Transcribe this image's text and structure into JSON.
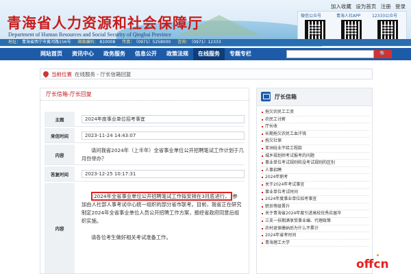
{
  "header": {
    "title": "青海省人力资源和社会保障厅",
    "subtitle": "Department of Human Resources and Social Security of Qinghai Province",
    "toplinks": [
      "加入收藏",
      "设为首页",
      "注册",
      "登录"
    ],
    "qr_labels": [
      "微信公众号",
      "青海人社APP",
      "12333公众号"
    ],
    "address_label": "地址：",
    "address": "青海省西宁市黄河路156号",
    "postcode_label": "邮政编码：",
    "postcode": "810008",
    "phone_label": "传真：",
    "phone": "（0971）5258000",
    "hotline_label": "咨询：",
    "hotline": "（0971）12333"
  },
  "nav": {
    "items": [
      "网站首页",
      "资讯中心",
      "政务服务",
      "信息公开",
      "政策法规",
      "在线服务",
      "专题专栏"
    ],
    "active": "在线服务",
    "search_button": "🔍"
  },
  "breadcrumb": {
    "current": "当前位置",
    "path": "在线服务 - 厅长信箱回复"
  },
  "letter": {
    "header": "厅长信箱-厅长回复",
    "rows": {
      "subject_label": "主题",
      "subject": "2024年度事业单位招考事宜",
      "letter_time_label": "来信时间",
      "letter_time": "2023-11-24 14:43:07",
      "content_label": "内容",
      "content": "请问我省2024年（上半年）全省事业单位公开招聘笔试工作计划于几月份举办？",
      "reply_time_label": "答复时间",
      "reply_time": "2023-12-25 10:17:31",
      "reply_label": "内容",
      "reply_highlight": "2024年全省事业单位公开招聘笔试工作拟安排在3月底进行，",
      "reply_rest": "参加由人社部人事考试中心统一组织的部分省市联考。目前，我省正在研究制定2024年全省事业单位人员公开招聘工作方案，报经省政府同意后组织实施。",
      "reply_end": "请各位考生做好相关考试准备工作。"
    }
  },
  "sidebar": {
    "title": "厅长信箱",
    "items": [
      "拖欠农民工工资",
      "农民工讨薪",
      "厅长收",
      "长期拖欠农民工血汗钱",
      "拖欠社保",
      "亚洲硅业不给工程款",
      "城乡规划师考试报考的问题",
      "事业单位考试规则和没考试规则的区别",
      "人事招聘",
      "2024年职考",
      "关于2024年考试事宜",
      "事业单位考试时间",
      "2024年度事业单位招考事宜",
      "职员等级晋升",
      "关于青海省2024年度引进高校优秀应届毕",
      "三支一扶期满享受事业编、代理政策",
      "农村退保缴纳后为什么不累计",
      "2024年省考时间",
      "青海理工大学"
    ]
  },
  "watermark": "offcn",
  "colors": {
    "title_red": "#c81d1d",
    "nav_blue": "#1d5ba8",
    "highlight_red": "#e02020"
  }
}
